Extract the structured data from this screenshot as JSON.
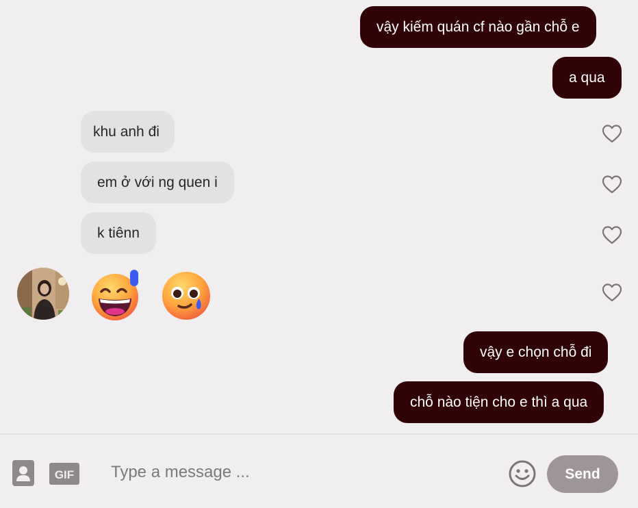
{
  "messages": {
    "m1": "vậy kiếm quán cf nào gần chỗ e",
    "m2": "a qua",
    "m3": "khu anh đi",
    "m4": "em ở với ng quen  i",
    "m5": "k tiênn",
    "m6": "vậy e chọn chỗ đi",
    "m7": "chỗ nào tiện cho e thì a qua"
  },
  "reactions": {
    "emoji_1": "grinning-sweat-emoji",
    "emoji_2": "teary-smile-emoji"
  },
  "composer": {
    "placeholder": "Type a message ...",
    "gif_label": "GIF",
    "send_label": "Send"
  },
  "colors": {
    "outgoing_bubble": "#300306",
    "incoming_bubble": "#e4e1e2",
    "background": "#f1eeef",
    "send_button": "#9e9597"
  }
}
